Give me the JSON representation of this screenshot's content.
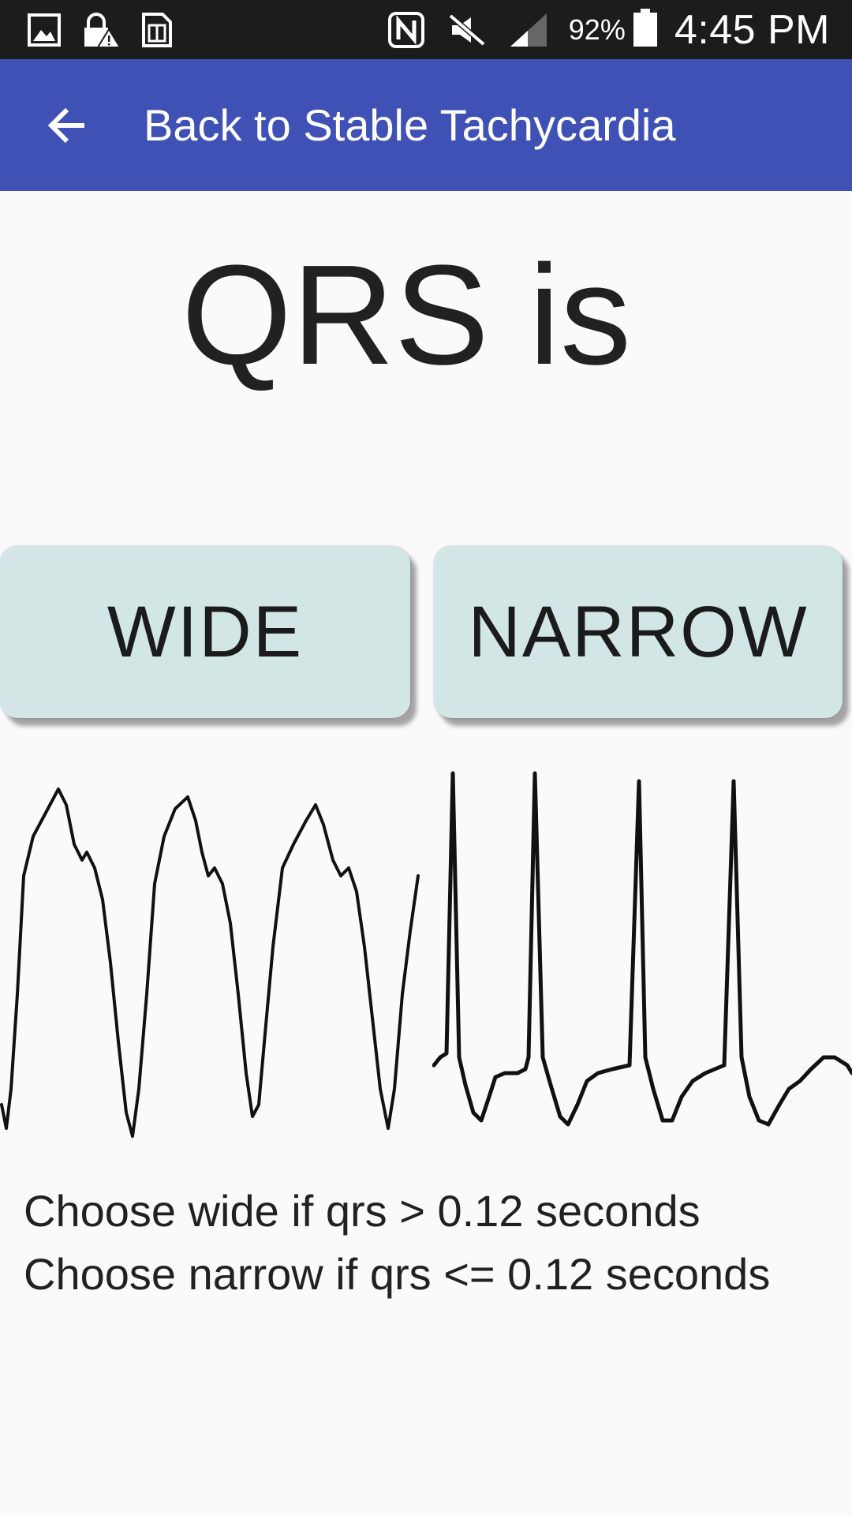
{
  "status_bar": {
    "icons_left": [
      "gallery-icon",
      "lock-warning-icon",
      "sim-card-icon"
    ],
    "icons_right": [
      "nfc-icon",
      "mute-icon",
      "signal-icon",
      "battery-icon"
    ],
    "battery_percent": "92%",
    "time": "4:45 PM"
  },
  "app_bar": {
    "back_icon": "arrow-left-icon",
    "title": "Back to Stable Tachycardia",
    "color": "#3f51b5"
  },
  "main": {
    "heading": "QRS is",
    "buttons": {
      "wide_label": "WIDE",
      "narrow_label": "NARROW",
      "color": "#d2e6e6"
    },
    "images": {
      "wide": "wide-qrs-ecg-strip",
      "narrow": "narrow-qrs-ecg-strip"
    },
    "guidance": {
      "line1": "Choose wide if qrs > 0.12 seconds",
      "line2": "Choose narrow if qrs <= 0.12 seconds"
    }
  }
}
